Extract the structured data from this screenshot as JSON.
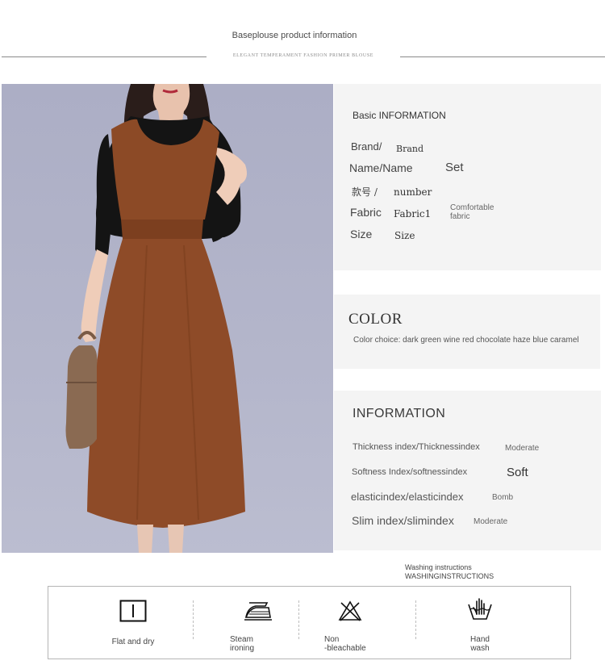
{
  "header": {
    "title": "Baseplouse product information",
    "subtitle": "ELEGANT TEMPERAMENT FASHION PRIMER BLOUSE"
  },
  "basic_info": {
    "title": "Basic INFORMATION",
    "rows": [
      {
        "label": "Brand/",
        "value": "Brand"
      },
      {
        "label": "Name/Name",
        "value": "Set"
      },
      {
        "label": "款号 /",
        "value": "number"
      },
      {
        "label": "Fabric",
        "value": "Fabric1",
        "note_line1": "Comfortable",
        "note_line2": "fabric"
      },
      {
        "label": "Size",
        "value": "Size"
      }
    ]
  },
  "color": {
    "title": "COLOR",
    "choice": "Color choice: dark green wine red chocolate haze blue caramel"
  },
  "information": {
    "title": "INFORMATION",
    "rows": [
      {
        "label": "Thickness index/Thicknessindex",
        "value": "Moderate"
      },
      {
        "label": "Softness Index/softnessindex",
        "value": "Soft"
      },
      {
        "label": "elasticindex/elasticindex",
        "value": "Bomb"
      },
      {
        "label": "Slim index/slimindex",
        "value": "Moderate"
      }
    ]
  },
  "washing": {
    "title_line1": "Washing instructions",
    "title_line2": "WASHINGINSTRUCTIONS",
    "items": [
      {
        "icon": "flat-dry-icon",
        "line1": "Flat and dry",
        "line2": ""
      },
      {
        "icon": "iron-icon",
        "line1": "Steam",
        "line2": "ironing"
      },
      {
        "icon": "no-bleach-icon",
        "line1": "Non",
        "line2": "-bleachable"
      },
      {
        "icon": "hand-wash-icon",
        "line1": "Hand",
        "line2": "wash"
      }
    ]
  }
}
